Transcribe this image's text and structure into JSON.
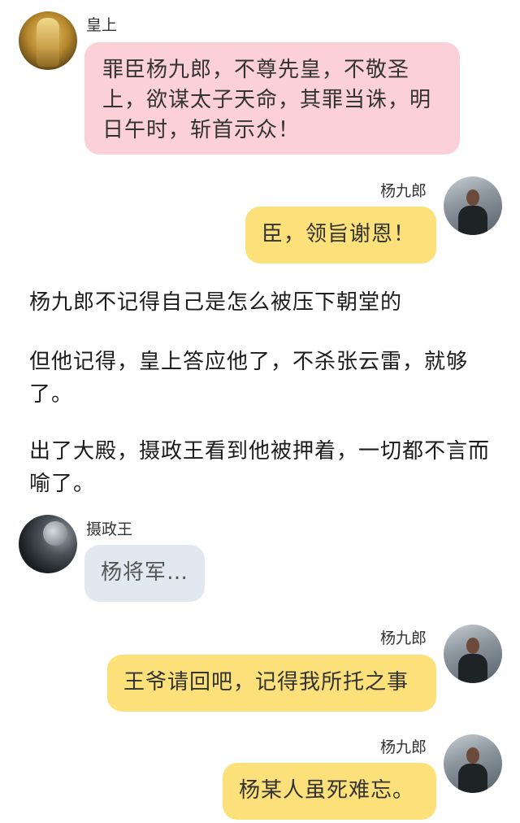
{
  "messages": [
    {
      "sender": "皇上",
      "text": "罪臣杨九郎，不尊先皇，不敬圣上，欲谋太子天命，其罪当诛，明日午时，斩首示众！",
      "color": "#fbd0d8"
    },
    {
      "sender": "杨九郎",
      "text": "臣，领旨谢恩！",
      "color": "#fce07a"
    },
    {
      "sender": "摄政王",
      "text": "杨将军…",
      "color": "#e1e8ef"
    },
    {
      "sender": "杨九郎",
      "text": "王爷请回吧，记得我所托之事",
      "color": "#fce07a"
    },
    {
      "sender": "杨九郎",
      "text": "杨某人虽死难忘。",
      "color": "#fce07a"
    }
  ],
  "narration": [
    "杨九郎不记得自己是怎么被压下朝堂的",
    "但他记得，皇上答应他了，不杀张云雷，就够了。",
    "出了大殿，摄政王看到他被押着，一切都不言而喻了。"
  ]
}
